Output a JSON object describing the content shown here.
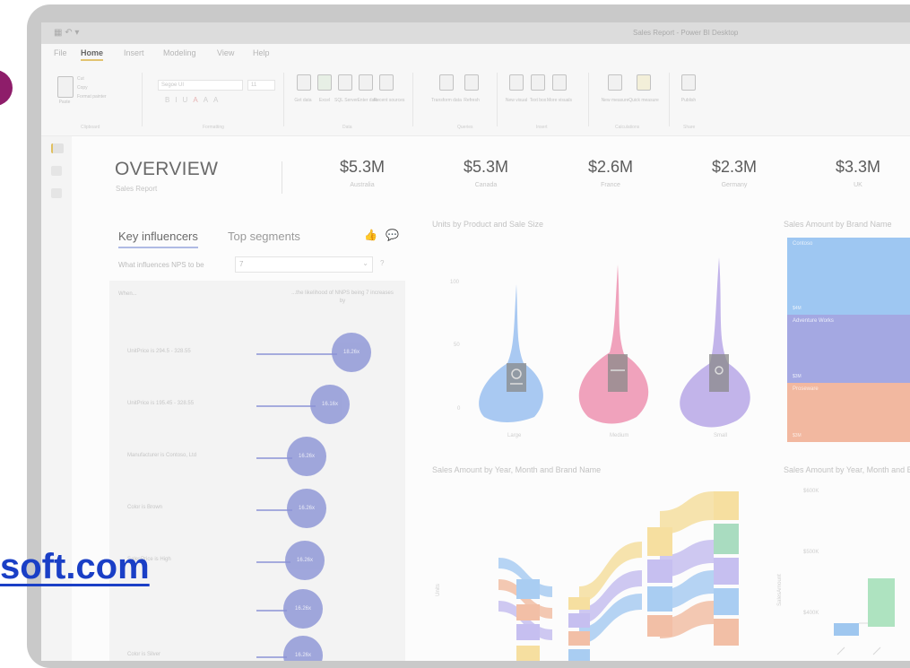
{
  "window_title": "Sales Report - Power BI Desktop",
  "menu": [
    "File",
    "Home",
    "Insert",
    "Modeling",
    "View",
    "Help"
  ],
  "active_menu": "Home",
  "ribbon_groups": [
    "Clipboard",
    "Formatting",
    "Data",
    "Queries",
    "Insert",
    "Calculations",
    "Share"
  ],
  "ribbon_buttons": [
    "Paste",
    "Cut",
    "Copy",
    "Format painter",
    "Get data",
    "Excel",
    "SQL Server",
    "Enter data",
    "Recent sources",
    "Transform data",
    "Refresh",
    "New visual",
    "Text box",
    "More visuals",
    "New measure",
    "Quick measure",
    "Publish"
  ],
  "font_box": "Segoe UI",
  "font_size": "11",
  "overview": {
    "title": "OVERVIEW",
    "subtitle": "Sales Report"
  },
  "kpis": [
    {
      "value": "$5.3M",
      "label": "Australia"
    },
    {
      "value": "$5.3M",
      "label": "Canada"
    },
    {
      "value": "$2.6M",
      "label": "France"
    },
    {
      "value": "$2.3M",
      "label": "Germany"
    },
    {
      "value": "$3.3M",
      "label": "UK"
    }
  ],
  "influencers": {
    "tab_active": "Key influencers",
    "tab_inactive": "Top segments",
    "question": "What influences NPS to be",
    "select_value": "7",
    "header_left": "When...",
    "header_right": "...the likelihood of NNPS being 7 increases by",
    "rows": [
      {
        "label": "UnitPrice is 294.5 - 328.55",
        "value": "18.26x"
      },
      {
        "label": "UnitPrice is 195.45 - 328.55",
        "value": "16.16x"
      },
      {
        "label": "Manufacturer is Contoso, Ltd",
        "value": "16.26x"
      },
      {
        "label": "Color is Brown",
        "value": "16.26x"
      },
      {
        "label": "SalesPrice is High",
        "value": "16.26x"
      },
      {
        "label": "",
        "value": "16.26x"
      },
      {
        "label": "Color is Silver",
        "value": "16.26x"
      }
    ]
  },
  "violin_chart": {
    "title": "Units by Product and Sale Size",
    "y_ticks": [
      "100",
      "50",
      "0"
    ],
    "categories": [
      "Large",
      "Medium",
      "Small"
    ],
    "colors": [
      "#a9c9f2",
      "#f0a2bc",
      "#c2b4ea"
    ]
  },
  "treemap": {
    "title": "Sales Amount by Brand Name",
    "blocks": [
      {
        "label": "Contoso",
        "value": 0.36,
        "color": "#9ec7f2"
      },
      {
        "label": "Adventure Works",
        "value": 0.3,
        "color": "#a4a8e2"
      },
      {
        "label": "Proseware",
        "value": 0.28,
        "color": "#f2b8a0"
      }
    ],
    "small_labels": [
      "$4M",
      "$3M",
      "$3M"
    ]
  },
  "sankey": {
    "title": "Sales Amount by Year, Month and Brand Name",
    "ylabel": "Units",
    "colors": [
      "#a9cdf2",
      "#f2bfa6",
      "#c6bff0",
      "#f6dfa0",
      "#a9dcc0"
    ]
  },
  "waterfall": {
    "title": "Sales Amount by Year, Month and Brand Name",
    "ylabel": "SalesAmount",
    "y_ticks": [
      "$600K",
      "$500K",
      "$400K"
    ]
  },
  "watermark": "soft.com"
}
